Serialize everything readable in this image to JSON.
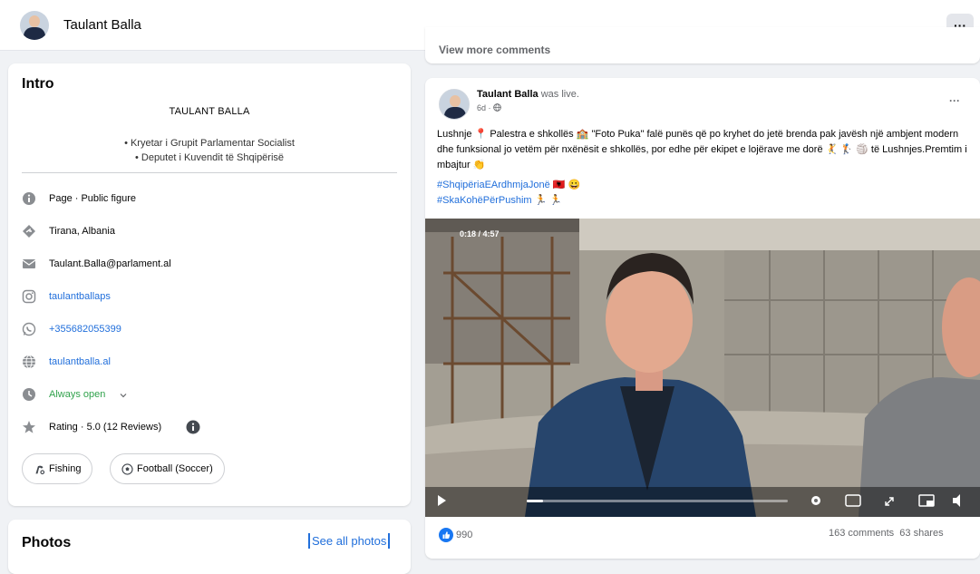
{
  "header": {
    "name": "Taulant Balla",
    "menu_label": "···"
  },
  "intro": {
    "title": "Intro",
    "name_caps": "TAULANT BALLA",
    "bio_lines": [
      "• Kryetar i Grupit Parlamentar Socialist",
      "• Deputet i Kuvendit të Shqipërisë"
    ],
    "details": [
      {
        "icon": "info-icon",
        "text": "Page · Public figure",
        "style": "plain"
      },
      {
        "icon": "location-icon",
        "text": "Tirana, Albania",
        "style": "plain"
      },
      {
        "icon": "email-icon",
        "text": "Taulant.Balla@parlament.al",
        "style": "plain"
      },
      {
        "icon": "instagram-icon",
        "text": "taulantballaps",
        "style": "link"
      },
      {
        "icon": "whatsapp-icon",
        "text": "+355682055399",
        "style": "link"
      },
      {
        "icon": "globe-icon",
        "text": "taulantballa.al",
        "style": "link"
      },
      {
        "icon": "clock-icon",
        "text": "Always open",
        "style": "green"
      },
      {
        "icon": "star-icon",
        "text": "Rating · 5.0 (12 Reviews)",
        "style": "plain"
      }
    ],
    "chips": [
      "Fishing",
      "Football (Soccer)"
    ]
  },
  "photos": {
    "title": "Photos",
    "see_all": "See all photos"
  },
  "previous_post": {
    "view_more": "View more comments"
  },
  "post": {
    "author": "Taulant Balla",
    "action": "was live.",
    "time": "6d ·",
    "text": "Lushnje 📍 Palestra e shkollës 🏫 \"Foto Puka\" falë punës që po kryhet do jetë brenda pak javësh një ambjent modern dhe funksional jo vetëm për nxënësit e shkollës, por edhe për ekipet e lojërave me dorë 🤾 🏌 🏐 të Lushnjes.Premtim i mbajtur 👏",
    "hashtags": [
      "#ShqipëriaEArdhmjaJonë 🇦🇱 😀",
      "#SkaKohëPërPushim 🏃 🏃"
    ],
    "video": {
      "time": "0:18 / 4:57",
      "progress": 0.06
    },
    "reactions": "990",
    "comments": "163 comments",
    "shares": "63 shares"
  },
  "colors": {
    "link": "#216fdb",
    "green": "#31a24c",
    "like": "#1877f2"
  }
}
